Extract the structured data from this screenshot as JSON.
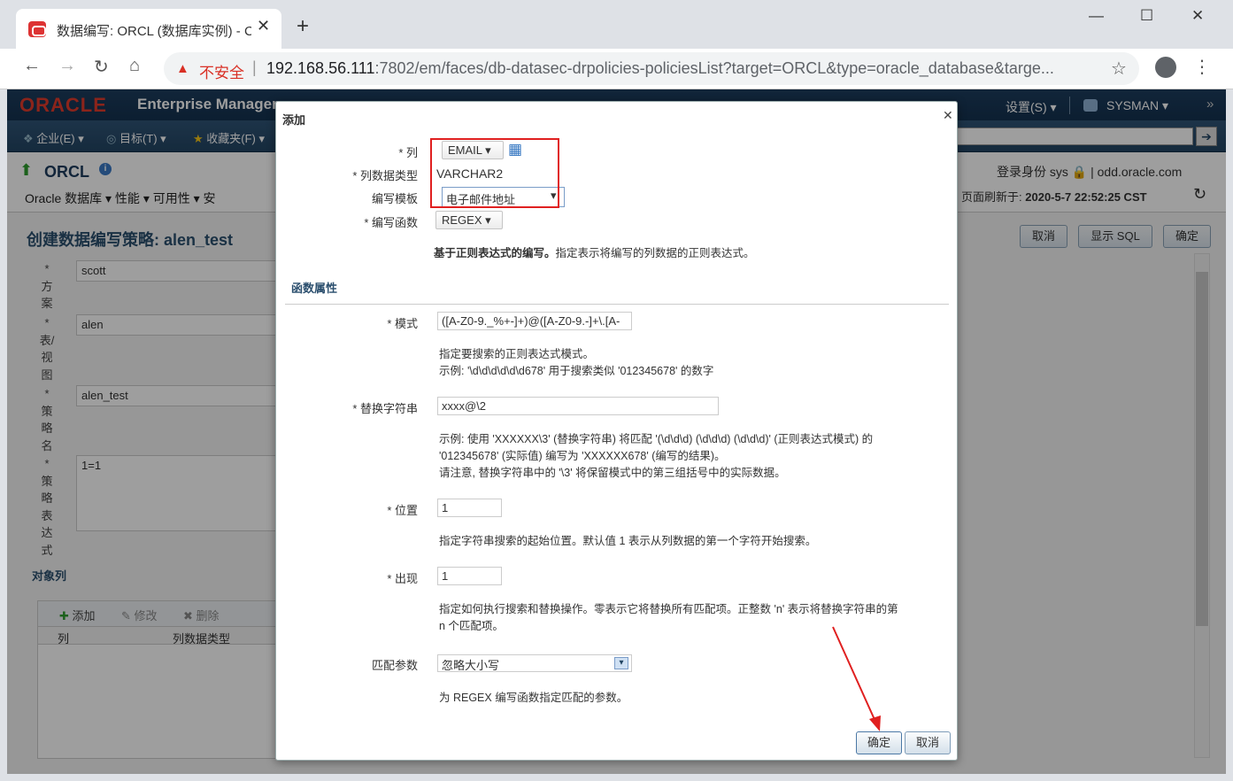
{
  "browser": {
    "tab_title": "数据编写: ORCL (数据库实例) - C",
    "tab_close": "✕",
    "new_tab": "+",
    "window_min": "—",
    "window_max": "☐",
    "window_close": "✕",
    "back": "←",
    "forward": "→",
    "reload": "↻",
    "home": "⌂",
    "insecure_label": "不安全",
    "url_host": "192.168.56.111",
    "url_rest": ":7802/em/faces/db-datasec-drpolicies-policiesList?target=ORCL&type=oracle_database&targe...",
    "star": "☆",
    "kebab": "⋮"
  },
  "app": {
    "oracle_logo": "ORACLE",
    "product_title": "Enterprise Manager",
    "settings_menu": "设置(S) ▾",
    "user_menu": "SYSMAN ▾",
    "close_panel": "»",
    "menu": {
      "enterprise": "企业(E) ▾",
      "targets": "目标(T) ▾",
      "favorites": "收藏夹(F) ▾"
    },
    "search_go": "➔",
    "target_name": "ORCL",
    "target_info": "i",
    "db_menu": "Oracle 数据库 ▾   性能 ▾   可用性 ▾   安",
    "login_info": "登录身份  sys 🔒 |  odd.oracle.com",
    "refresh_label": "页面刷新于:",
    "refresh_time": "2020-5-7 22:52:25 CST",
    "refresh_icon": "↻",
    "page_title": "创建数据编写策略: alen_test",
    "buttons": {
      "cancel": "取消",
      "show_sql": "显示 SQL",
      "ok": "确定"
    },
    "form": {
      "schema_label": "*\n方\n案",
      "schema_value": "scott",
      "table_label": "*\n表/\n视\n图",
      "table_value": "alen",
      "policy_label": "*\n策\n略\n名",
      "policy_value": "alen_test",
      "expr_label": "*\n策\n略\n表\n达\n式",
      "expr_value": "1=1"
    },
    "object_columns": {
      "heading": "对象列",
      "add": "添加",
      "edit": "修改",
      "delete": "删除",
      "col_header": "列",
      "type_header": "列数据类型"
    }
  },
  "dialog": {
    "title": "添加",
    "close": "✕",
    "column": {
      "label": "* 列",
      "value": "EMAIL ▾",
      "picker_icon": "▦"
    },
    "column_type": {
      "label": "* 列数据类型",
      "value": "VARCHAR2"
    },
    "template": {
      "label": "编写模板",
      "value": "电子邮件地址",
      "arrow": "▾"
    },
    "function": {
      "label": "* 编写函数",
      "value": "REGEX ▾"
    },
    "function_desc_bold": "基于正则表达式的编写。",
    "function_desc_rest": "指定表示将编写的列数据的正则表达式。",
    "section_title": "函数属性",
    "pattern": {
      "label": "* 模式",
      "value": "([A-Z0-9._%+-]+)@([A-Z0-9.-]+\\.[A-",
      "help1": "指定要搜索的正则表达式模式。",
      "help2": "示例: '\\d\\d\\d\\d\\d\\d678' 用于搜索类似 '012345678' 的数字"
    },
    "replace": {
      "label": "* 替换字符串",
      "value": "xxxx@\\2",
      "help1": "示例: 使用 'XXXXXX\\3' (替换字符串) 将匹配 '(\\d\\d\\d) (\\d\\d\\d) (\\d\\d\\d)' (正则表达式模式) 的",
      "help2": "'012345678' (实际值) 编写为 'XXXXXX678' (编写的结果)。",
      "help3": "请注意, 替换字符串中的 '\\3' 将保留模式中的第三组括号中的实际数据。"
    },
    "position": {
      "label": "* 位置",
      "value": "1",
      "help": "指定字符串搜索的起始位置。默认值 1 表示从列数据的第一个字符开始搜索。"
    },
    "occurrence": {
      "label": "* 出现",
      "value": "1",
      "help1": "指定如何执行搜索和替换操作。零表示它将替换所有匹配项。正整数 'n' 表示将替换字符串的第",
      "help2": "n 个匹配项。"
    },
    "match_param": {
      "label": "匹配参数",
      "value": "忽略大小写",
      "arrow": "▾",
      "help": "为 REGEX 编写函数指定匹配的参数。"
    },
    "ok": "确定",
    "cancel": "取消"
  },
  "colors": {
    "annotation_red": "#e02020",
    "brand_navy": "#1d3d5e",
    "oracle_red": "#e03a2c"
  }
}
